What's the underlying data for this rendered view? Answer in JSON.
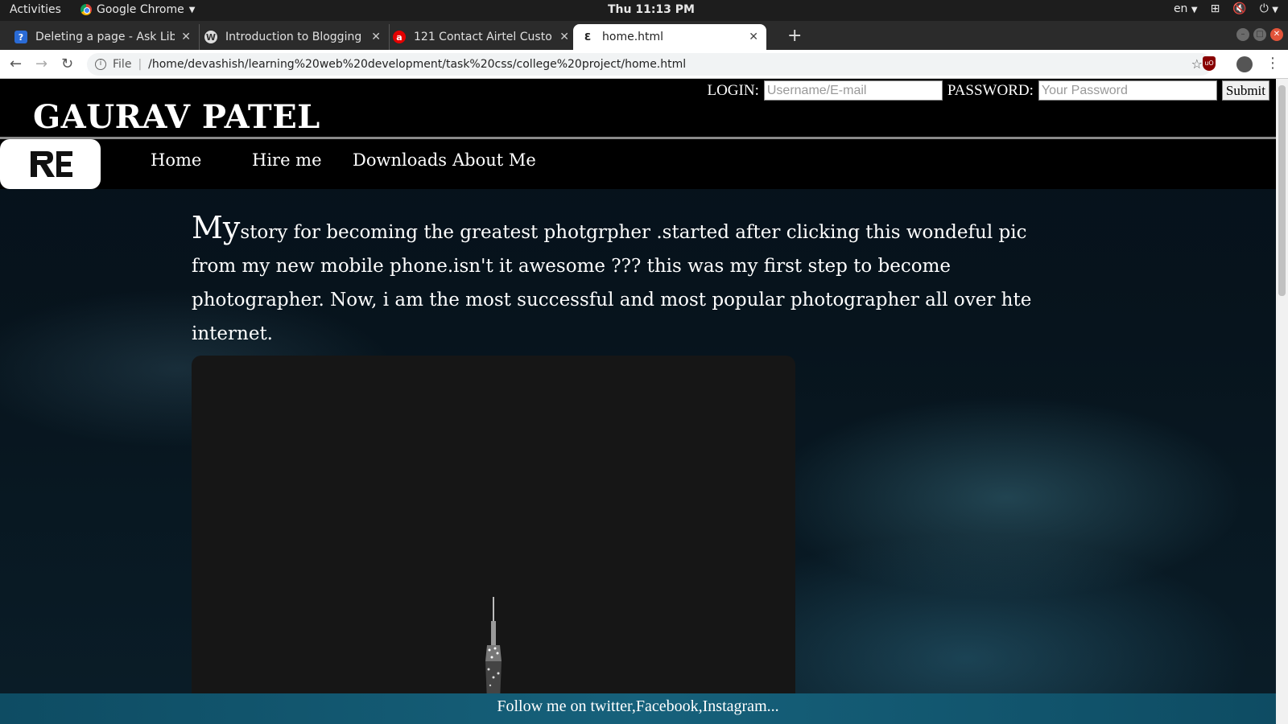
{
  "os_bar": {
    "activities": "Activities",
    "app_name": "Google Chrome",
    "clock": "Thu 11:13 PM",
    "language": "en"
  },
  "browser": {
    "tabs": [
      {
        "title": "Deleting a page - Ask Libr",
        "favicon": "question-icon"
      },
      {
        "title": "Introduction to Blogging",
        "favicon": "wordpress-icon"
      },
      {
        "title": "121 Contact Airtel Custom",
        "favicon": "airtel-icon"
      },
      {
        "title": "home.html",
        "favicon": "site-logo-icon"
      }
    ],
    "url_scheme": "File",
    "url": "/home/devashish/learning%20web%20development/task%20css/college%20project/home.html"
  },
  "site": {
    "name": "GAURAV PATEL",
    "login_label": "LOGIN:",
    "username_placeholder": "Username/E-mail",
    "password_label": "PASSWORD:",
    "password_placeholder": "Your Password",
    "submit_label": "Submit",
    "nav": [
      "Home",
      "Hire me",
      "Downloads",
      "About Me"
    ],
    "story_lead": "My",
    "story_text": "story for becoming the greatest photgrpher .started after clicking this wondeful pic from my new mobile phone.isn't it awesome ??? this was my first step to become photographer. Now, i am the most successful and most popular photographer all over hte internet.",
    "footer": "Follow me on twitter,Facebook,Instagram..."
  }
}
